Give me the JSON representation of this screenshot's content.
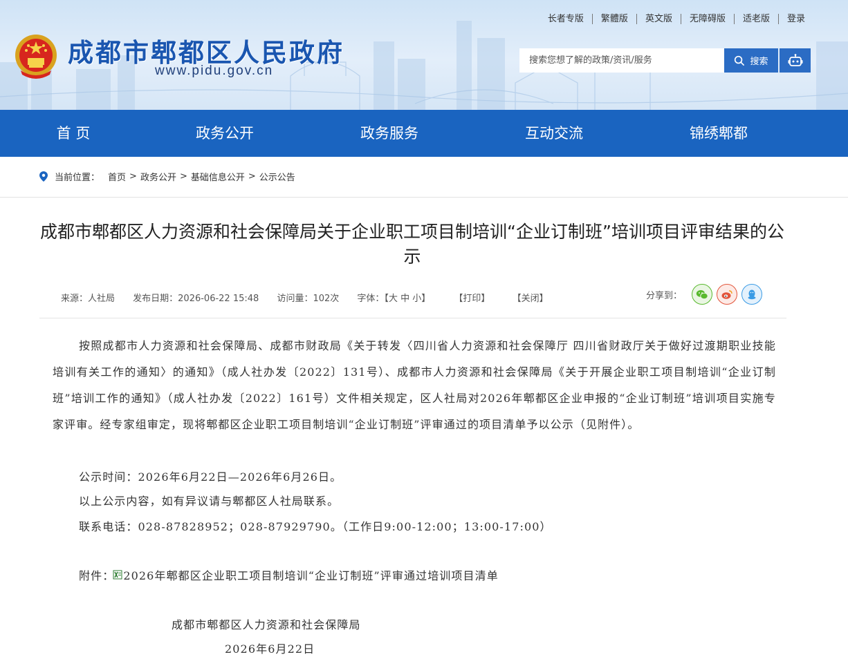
{
  "header": {
    "site_title": "成都市郫都区人民政府",
    "site_url": "www.pidu.gov.cn",
    "top_links": [
      "长者专版",
      "繁體版",
      "英文版",
      "无障碍版",
      "适老版",
      "登录"
    ],
    "search": {
      "placeholder": "搜索您想了解的政策/资讯/服务",
      "button_label": "搜索"
    }
  },
  "nav": {
    "items": [
      "首 页",
      "政务公开",
      "政务服务",
      "互动交流",
      "锦绣郫都"
    ]
  },
  "breadcrumb": {
    "label": "当前位置：",
    "items": [
      "首页",
      "政务公开",
      "基础信息公开",
      "公示公告"
    ],
    "separator": ">"
  },
  "article": {
    "title": "成都市郫都区人力资源和社会保障局关于企业职工项目制培训“企业订制班”培训项目评审结果的公示",
    "meta": {
      "source": "来源：人社局",
      "date": "发布日期：2026-06-22 15:48",
      "views": "访问量：102次",
      "font_label": "字体：【",
      "font_large": "大",
      "font_medium": "中",
      "font_small": "小",
      "font_close": "】",
      "print": "【打印】",
      "close": "【关闭】"
    },
    "share_label": "分享到：",
    "share_icons": [
      "wechat-icon",
      "weibo-icon",
      "qq-icon"
    ],
    "paragraph_1": "按照成都市人力资源和社会保障局、成都市财政局《关于转发〈四川省人力资源和社会保障厅 四川省财政厅关于做好过渡期职业技能培训有关工作的通知〉的通知》（成人社办发〔2022〕131号）、成都市人力资源和社会保障局《关于开展企业职工项目制培训“企业订制班”培训工作的通知》（成人社办发〔2022〕161号）文件相关规定，区人社局对2026年郫都区企业申报的“企业订制班”培训项目实施专家评审。经专家组审定，现将郫都区企业职工项目制培训“企业订制班”评审通过的项目清单予以公示（见附件）。",
    "line_period": "公示时间：2026年6月22日—2026年6月26日。",
    "line_objection": "以上公示内容，如有异议请与郫都区人社局联系。",
    "line_phone": "联系电话：028-87828952；028-87929790。（工作日9:00-12:00；13:00-17:00）",
    "attachment_label": "附件：",
    "attachment_name": "2026年郫都区企业职工项目制培训“企业订制班”评审通过培训项目清单",
    "signature": "成都市郫都区人力资源和社会保障局",
    "sign_date": "2026年6月22日"
  },
  "colors": {
    "nav_blue": "#1a64c0",
    "button_blue": "#2b6cc4",
    "title_blue": "#1a56b0"
  }
}
